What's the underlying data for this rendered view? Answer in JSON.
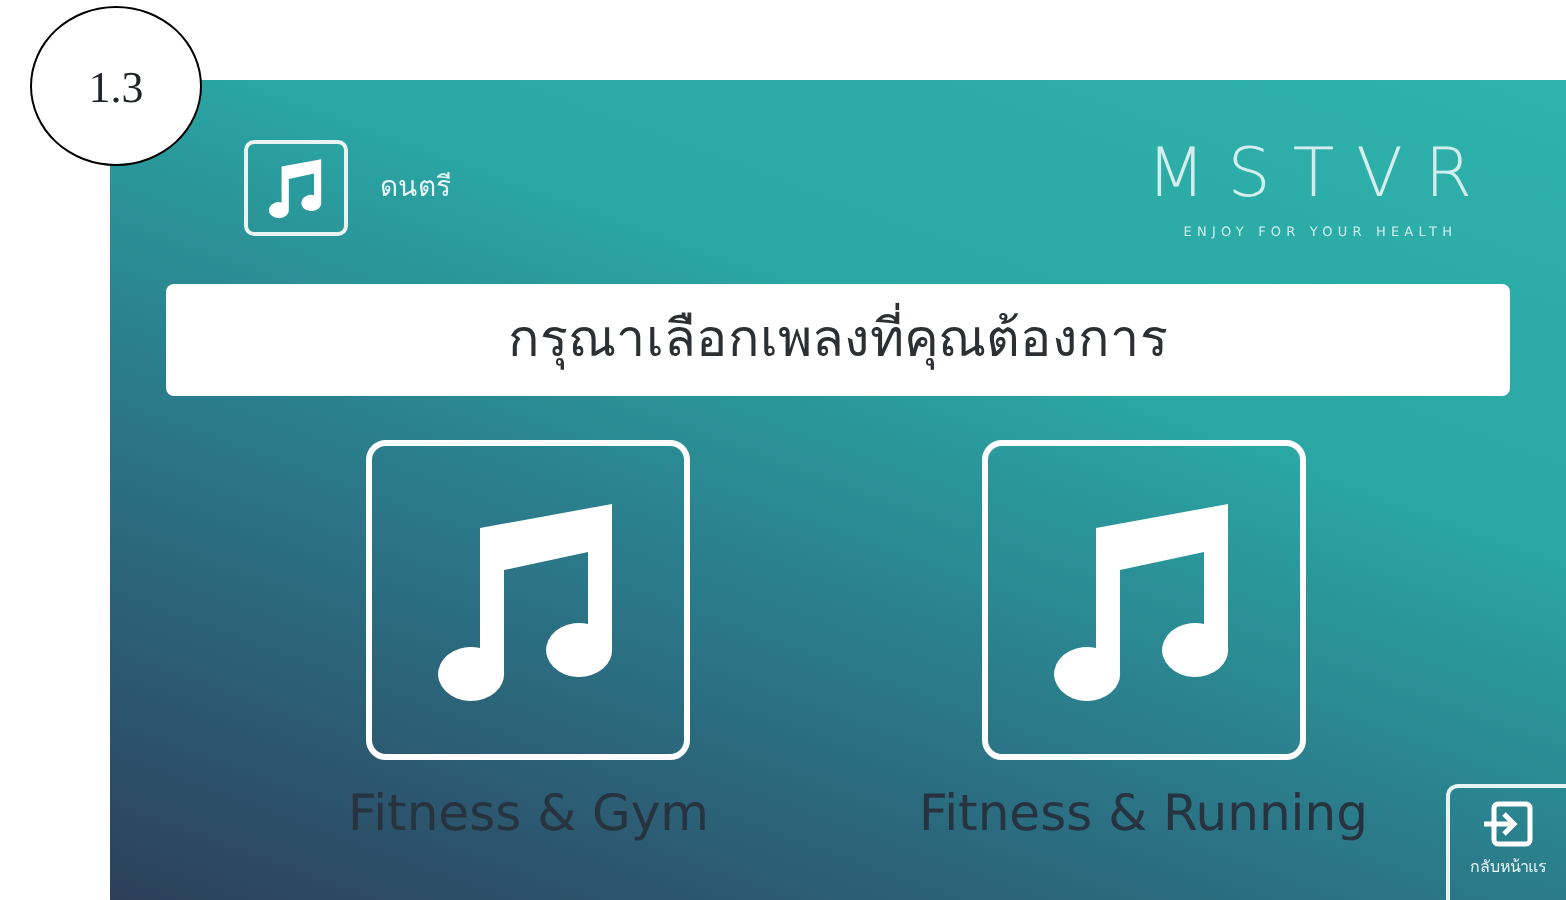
{
  "annotation": "1.3",
  "header": {
    "title": "ดนตรี"
  },
  "logo": {
    "name": "MSTVR",
    "tagline": "ENJOY FOR YOUR HEALTH"
  },
  "prompt": "กรุณาเลือกเพลงที่คุณต้องการ",
  "options": [
    {
      "label": "Fitness & Gym"
    },
    {
      "label": "Fitness & Running"
    }
  ],
  "back_button": {
    "label": "กลับหน้าแร"
  }
}
